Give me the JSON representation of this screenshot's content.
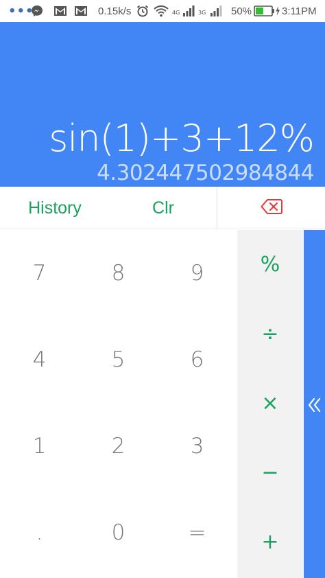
{
  "status_bar": {
    "dots": "•••",
    "network_speed": "0.15k/s",
    "net_4g": "4G",
    "net_3g": "3G",
    "battery_percent": "50%",
    "time": "3:11PM",
    "icons": [
      "messenger-icon",
      "gmail-icon",
      "gmail-icon",
      "alarm-icon",
      "wifi-icon",
      "signal-icon",
      "signal-icon",
      "battery-charging-icon"
    ]
  },
  "display": {
    "expression": "sin(1)+3+12%",
    "result": "4.302447502984844"
  },
  "actions": {
    "history_label": "History",
    "clear_label": "Clr",
    "backspace_icon": "backspace-icon"
  },
  "keys": {
    "k7": "7",
    "k8": "8",
    "k9": "9",
    "k4": "4",
    "k5": "5",
    "k6": "6",
    "k1": "1",
    "k2": "2",
    "k3": "3",
    "kdot": ".",
    "k0": "0",
    "keq": "="
  },
  "operators": {
    "percent": "%",
    "divide": "÷",
    "multiply": "×",
    "minus": "−",
    "plus": "+"
  },
  "colors": {
    "primary": "#4285f4",
    "accent": "#1aa260",
    "backspace": "#e53935",
    "key_text": "#757575",
    "operator_panel": "#f2f2f2"
  }
}
